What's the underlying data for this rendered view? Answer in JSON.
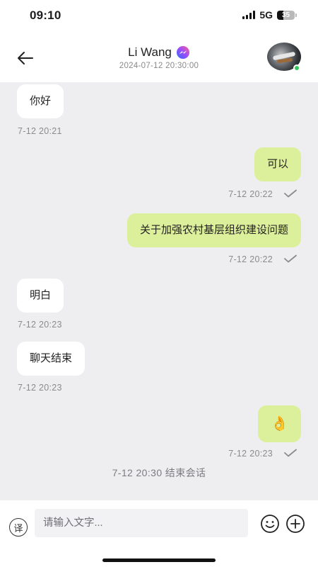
{
  "status_bar": {
    "time": "09:10",
    "network": "5G",
    "battery": "35",
    "battery_level_percent": 35,
    "signal_bars": 4
  },
  "header": {
    "contact_name": "Li Wang",
    "subtitle": "2024-07-12 20:30:00",
    "back_icon": "arrow-left-icon",
    "badge_icon": "messenger-icon",
    "online": true
  },
  "messages": [
    {
      "direction": "in",
      "text": "你好",
      "time": "7-12 20:21"
    },
    {
      "direction": "out",
      "text": "可以",
      "time": "7-12 20:22",
      "read": true
    },
    {
      "direction": "out",
      "text": "关于加强农村基层组织建设问题",
      "time": "7-12 20:22",
      "read": true
    },
    {
      "direction": "in",
      "text": "明白",
      "time": "7-12 20:23"
    },
    {
      "direction": "in",
      "text": "聊天结束",
      "time": "7-12 20:23"
    },
    {
      "direction": "out",
      "text": "👌",
      "time": "7-12 20:23",
      "read": true
    }
  ],
  "system_message": "7-12 20:30 结束会话",
  "input_bar": {
    "translate_label": "译",
    "placeholder": "请输入文字...",
    "emoji_icon": "smiley-icon",
    "add_icon": "plus-circle-icon"
  },
  "colors": {
    "outgoing_bubble": "#dcef9a",
    "incoming_bubble": "#ffffff",
    "chat_background": "#eeeef0",
    "online": "#35c759"
  }
}
